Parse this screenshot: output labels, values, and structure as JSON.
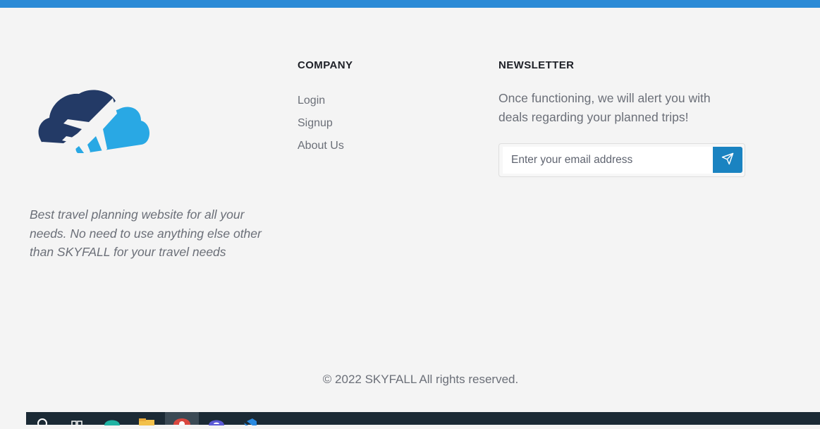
{
  "brand": {
    "tagline": "Best travel planning website for all your needs. No need to use anything else other than SKYFALL for your travel needs",
    "logo_icon": "cloud-plane-logo",
    "colors": {
      "top_bar": "#2b8ad6",
      "logo_dark": "#233a66",
      "logo_light": "#29a8e4",
      "accent_button": "#1a83c1"
    }
  },
  "company": {
    "title": "COMPANY",
    "links": [
      {
        "label": "Login"
      },
      {
        "label": "Signup"
      },
      {
        "label": "About Us"
      }
    ]
  },
  "newsletter": {
    "title": "NEWSLETTER",
    "text": "Once functioning, we will alert you with deals regarding your planned trips!",
    "email_placeholder": "Enter your email address",
    "send_icon": "paper-plane-icon"
  },
  "copyright": "© 2022 SKYFALL All rights reserved.",
  "taskbar": {
    "icons": [
      "search-icon",
      "task-view-icon",
      "edge-icon",
      "file-explorer-icon",
      "chrome-icon",
      "app-icon",
      "vscode-icon"
    ]
  }
}
